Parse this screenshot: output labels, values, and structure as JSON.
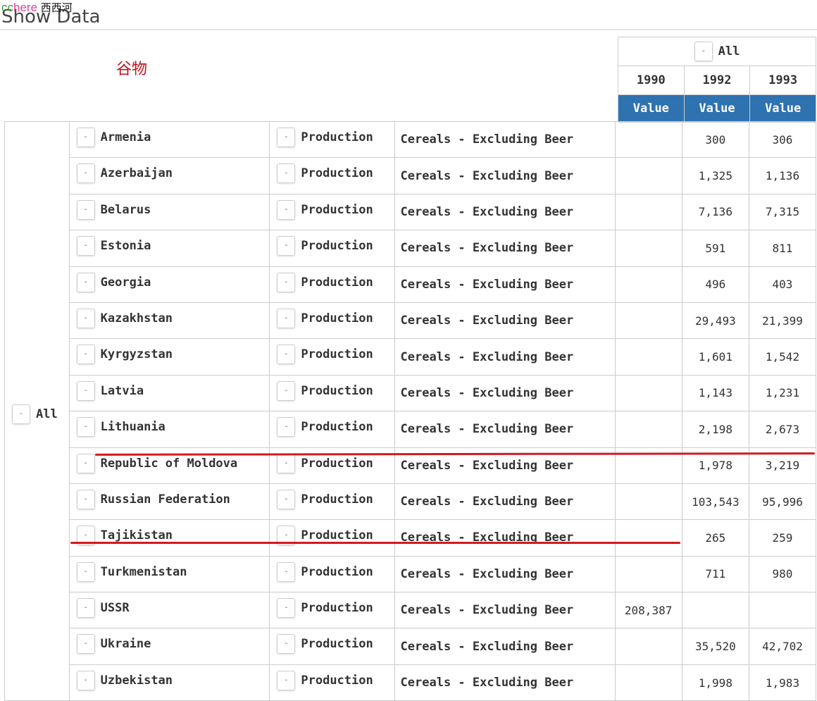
{
  "watermark": {
    "a": "cc",
    "b": "here",
    "c": "西西河"
  },
  "page_title": "Show Data",
  "annotation": "谷物",
  "header": {
    "filter_label": "All",
    "years": [
      "1990",
      "1992",
      "1993"
    ],
    "measure_label": "Value"
  },
  "row_group": "All",
  "rows": [
    {
      "country": "Armenia",
      "element": "Production",
      "item": "Cereals - Excluding Beer",
      "v1990": "",
      "v1992": "300",
      "v1993": "306"
    },
    {
      "country": "Azerbaijan",
      "element": "Production",
      "item": "Cereals - Excluding Beer",
      "v1990": "",
      "v1992": "1,325",
      "v1993": "1,136"
    },
    {
      "country": "Belarus",
      "element": "Production",
      "item": "Cereals - Excluding Beer",
      "v1990": "",
      "v1992": "7,136",
      "v1993": "7,315"
    },
    {
      "country": "Estonia",
      "element": "Production",
      "item": "Cereals - Excluding Beer",
      "v1990": "",
      "v1992": "591",
      "v1993": "811"
    },
    {
      "country": "Georgia",
      "element": "Production",
      "item": "Cereals - Excluding Beer",
      "v1990": "",
      "v1992": "496",
      "v1993": "403"
    },
    {
      "country": "Kazakhstan",
      "element": "Production",
      "item": "Cereals - Excluding Beer",
      "v1990": "",
      "v1992": "29,493",
      "v1993": "21,399"
    },
    {
      "country": "Kyrgyzstan",
      "element": "Production",
      "item": "Cereals - Excluding Beer",
      "v1990": "",
      "v1992": "1,601",
      "v1993": "1,542"
    },
    {
      "country": "Latvia",
      "element": "Production",
      "item": "Cereals - Excluding Beer",
      "v1990": "",
      "v1992": "1,143",
      "v1993": "1,231"
    },
    {
      "country": "Lithuania",
      "element": "Production",
      "item": "Cereals - Excluding Beer",
      "v1990": "",
      "v1992": "2,198",
      "v1993": "2,673"
    },
    {
      "country": "Republic of Moldova",
      "element": "Production",
      "item": "Cereals - Excluding Beer",
      "v1990": "",
      "v1992": "1,978",
      "v1993": "3,219"
    },
    {
      "country": "Russian Federation",
      "element": "Production",
      "item": "Cereals - Excluding Beer",
      "v1990": "",
      "v1992": "103,543",
      "v1993": "95,996"
    },
    {
      "country": "Tajikistan",
      "element": "Production",
      "item": "Cereals - Excluding Beer",
      "v1990": "",
      "v1992": "265",
      "v1993": "259"
    },
    {
      "country": "Turkmenistan",
      "element": "Production",
      "item": "Cereals - Excluding Beer",
      "v1990": "",
      "v1992": "711",
      "v1993": "980"
    },
    {
      "country": "USSR",
      "element": "Production",
      "item": "Cereals - Excluding Beer",
      "v1990": "208,387",
      "v1992": "",
      "v1993": ""
    },
    {
      "country": "Ukraine",
      "element": "Production",
      "item": "Cereals - Excluding Beer",
      "v1990": "",
      "v1992": "35,520",
      "v1993": "42,702"
    },
    {
      "country": "Uzbekistan",
      "element": "Production",
      "item": "Cereals - Excluding Beer",
      "v1990": "",
      "v1992": "1,998",
      "v1993": "1,983"
    }
  ],
  "colors": {
    "header_blue": "#2e72b0",
    "highlight_red": "#d11a22",
    "annotation_red": "#c0141c"
  }
}
